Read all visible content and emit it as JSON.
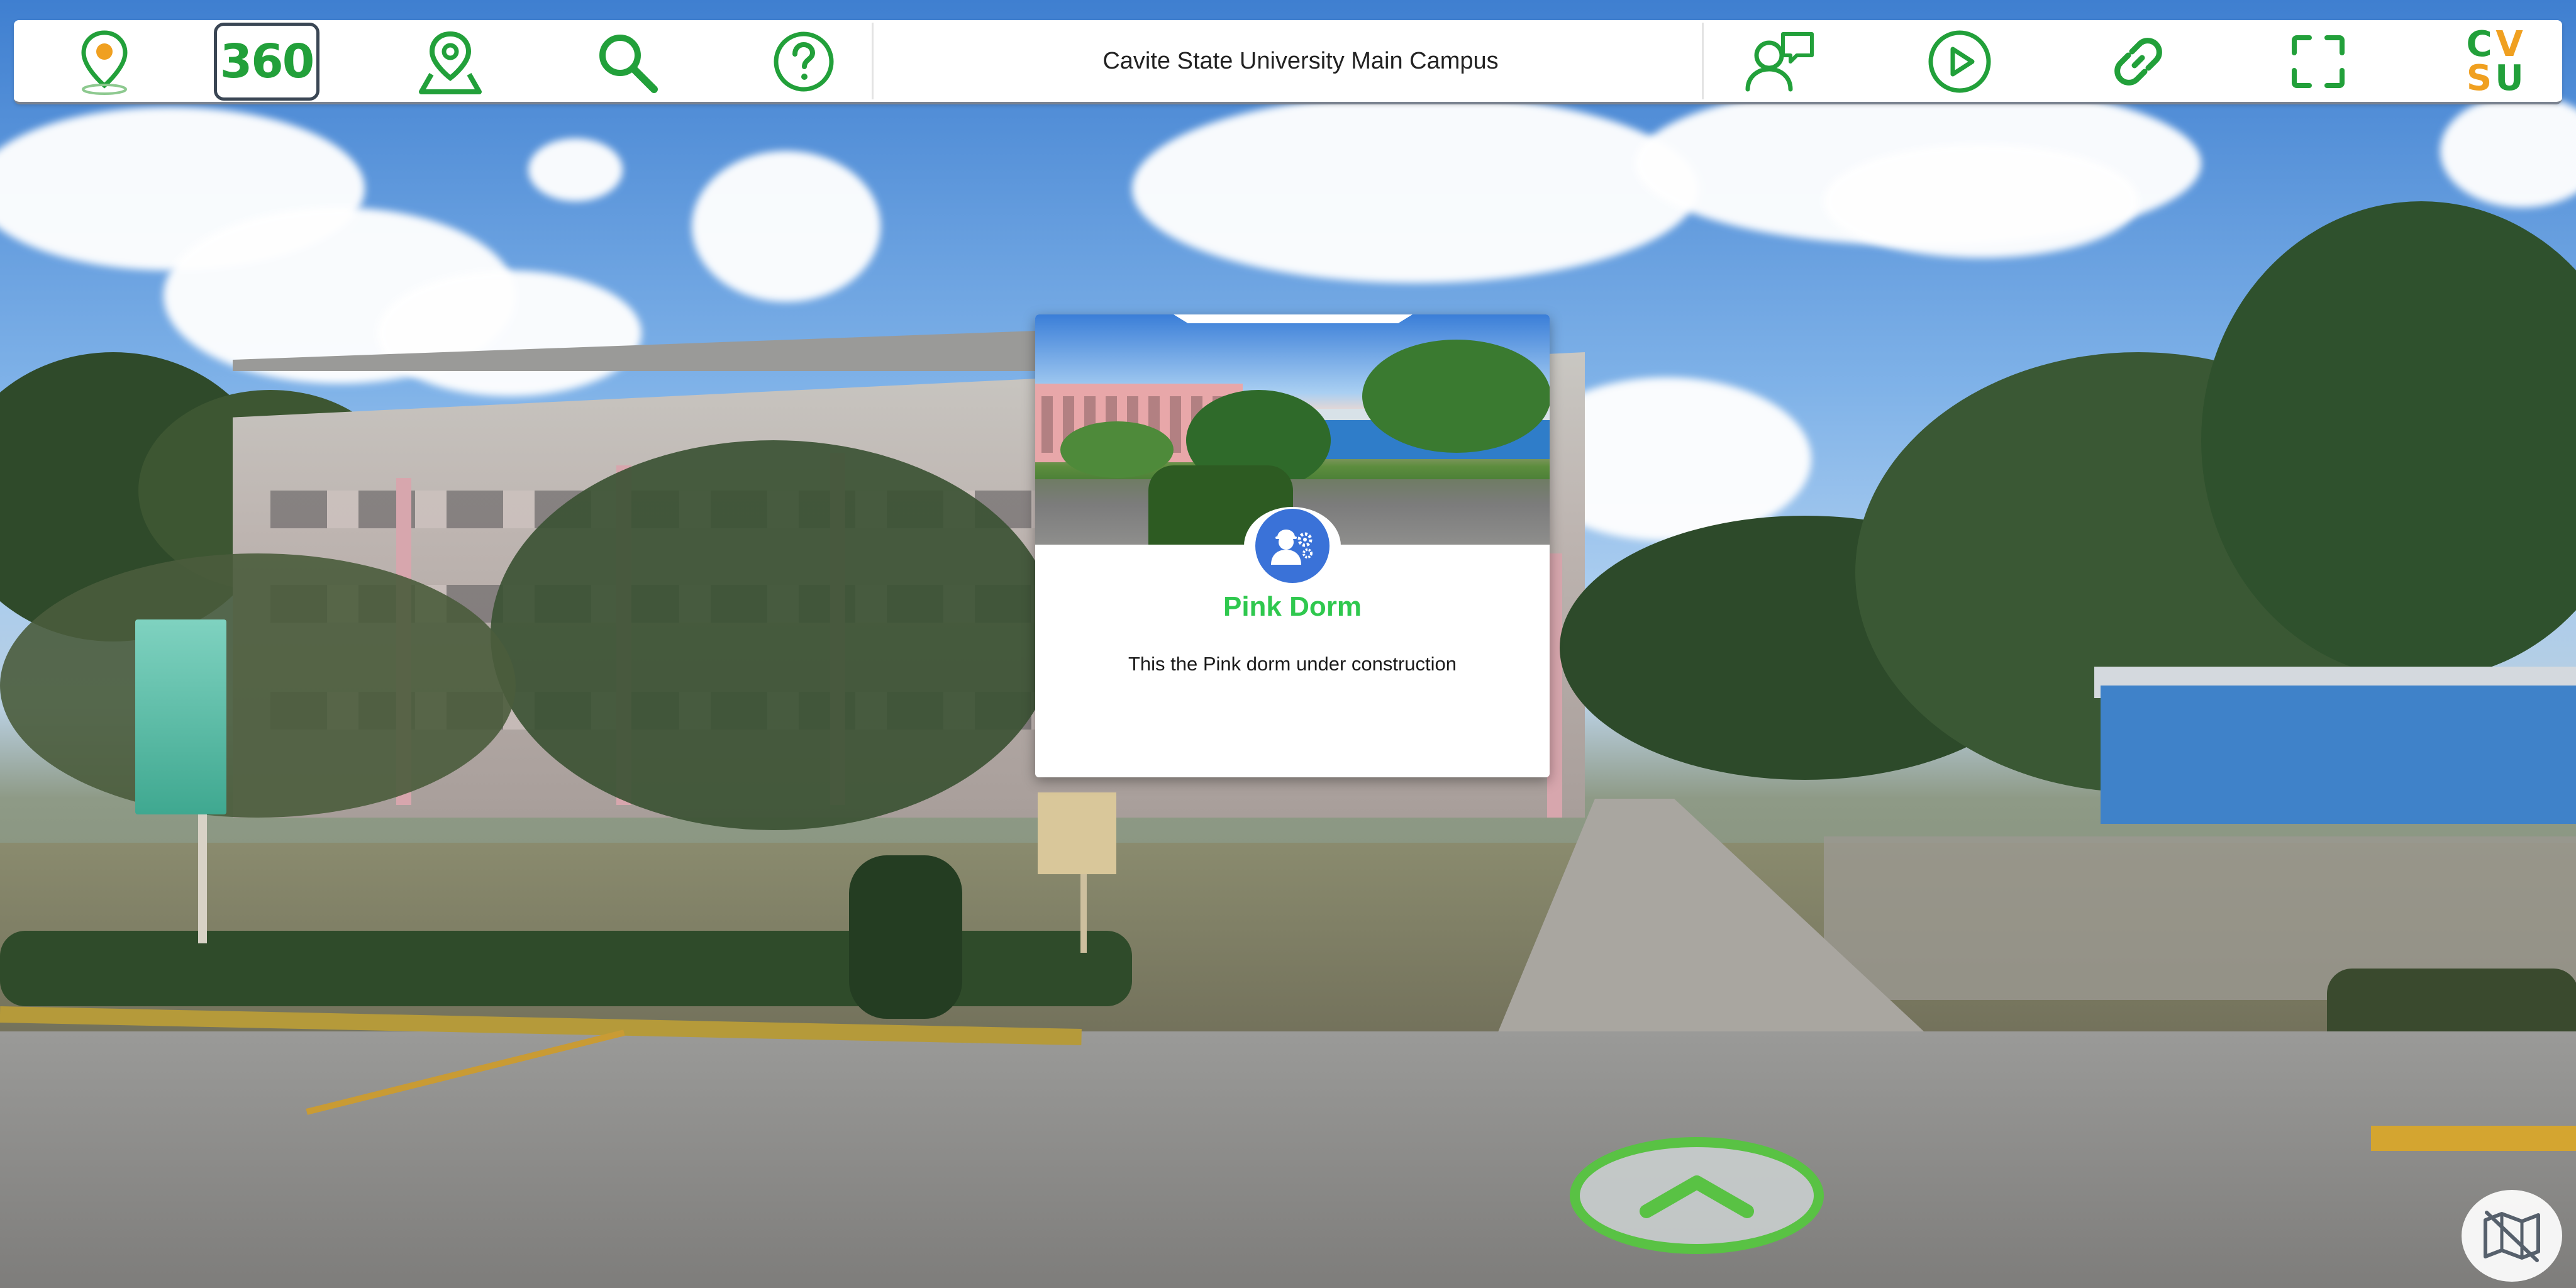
{
  "toolbar": {
    "title": "Cavite State University Main Campus",
    "button_360_label": "360",
    "logo_letters": [
      "C",
      "V",
      "S",
      "U"
    ],
    "left_buttons": [
      "location-pin-logo",
      "360-view",
      "map-marker",
      "search",
      "help"
    ],
    "right_buttons": [
      "feedback-chat",
      "play-tour",
      "share-link",
      "fullscreen",
      "cvsu-logo"
    ]
  },
  "info_card": {
    "title": "Pink Dorm",
    "description": "This the Pink dorm under construction",
    "badge_icon": "worker-gear-icon"
  },
  "controls": {
    "nav_arrow": "chevron-up-icon",
    "map_toggle": "map-off-icon"
  },
  "colors": {
    "accent_green": "#22a03a",
    "title_green": "#2fc84e",
    "badge_blue": "#3a72d8",
    "logo_orange": "#f0a020",
    "arrow_ring": "#59c244"
  }
}
